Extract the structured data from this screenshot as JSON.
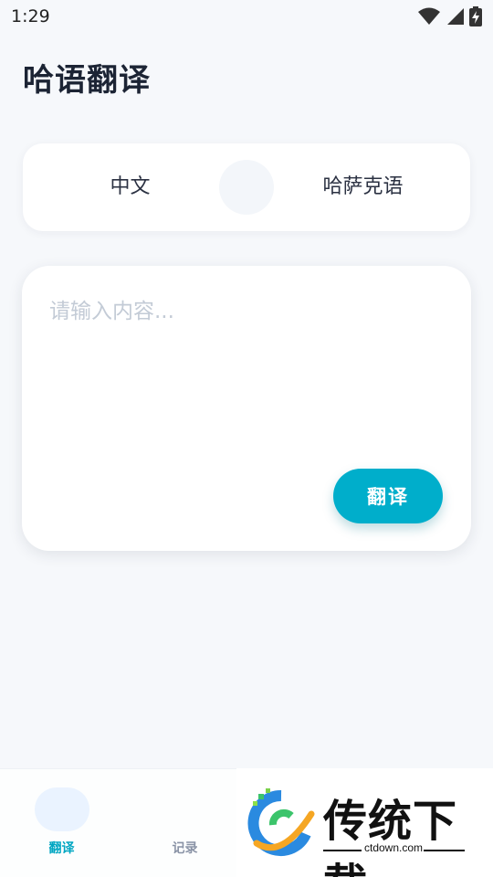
{
  "status_bar": {
    "time": "1:29",
    "icons": [
      "wifi-icon",
      "signal-icon",
      "battery-charging-icon"
    ]
  },
  "header": {
    "title": "哈语翻译"
  },
  "language_selector": {
    "source": "中文",
    "target": "哈萨克语",
    "swap_icon": "swap-icon"
  },
  "input": {
    "placeholder": "请输入内容...",
    "value": ""
  },
  "actions": {
    "translate_label": "翻译"
  },
  "bottom_nav": {
    "items": [
      {
        "label": "翻译",
        "active": true
      },
      {
        "label": "记录",
        "active": false
      }
    ]
  },
  "watermark": {
    "brand": "传统下载",
    "url": "ctdown.com"
  },
  "colors": {
    "accent": "#00aecb",
    "background": "#f6f8fb",
    "card": "#ffffff",
    "title": "#1c2434",
    "placeholder": "#c3cbd6"
  }
}
